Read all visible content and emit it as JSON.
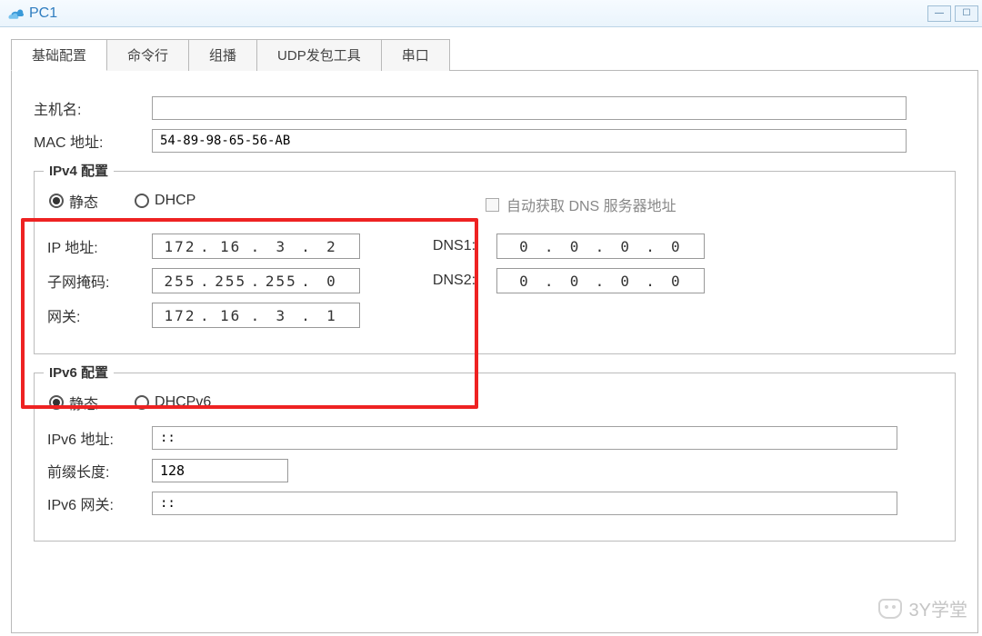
{
  "window": {
    "title": "PC1"
  },
  "tabs": {
    "t0": "基础配置",
    "t1": "命令行",
    "t2": "组播",
    "t3": "UDP发包工具",
    "t4": "串口"
  },
  "basic": {
    "hostname_label": "主机名:",
    "hostname_value": "",
    "mac_label": "MAC 地址:",
    "mac_value": "54-89-98-65-56-AB"
  },
  "ipv4": {
    "legend": "IPv4 配置",
    "static_label": "静态",
    "dhcp_label": "DHCP",
    "auto_dns_label": "自动获取 DNS 服务器地址",
    "ip_label": "IP 地址:",
    "ip": [
      "172",
      "16",
      "3",
      "2"
    ],
    "mask_label": "子网掩码:",
    "mask": [
      "255",
      "255",
      "255",
      "0"
    ],
    "gw_label": "网关:",
    "gw": [
      "172",
      "16",
      "3",
      "1"
    ],
    "dns1_label": "DNS1:",
    "dns1": [
      "0",
      "0",
      "0",
      "0"
    ],
    "dns2_label": "DNS2:",
    "dns2": [
      "0",
      "0",
      "0",
      "0"
    ]
  },
  "ipv6": {
    "legend": "IPv6 配置",
    "static_label": "静态",
    "dhcp_label": "DHCPv6",
    "addr_label": "IPv6 地址:",
    "addr_value": "::",
    "prefix_label": "前缀长度:",
    "prefix_value": "128",
    "gw_label": "IPv6 网关:",
    "gw_value": "::"
  },
  "watermark": "3Y学堂"
}
